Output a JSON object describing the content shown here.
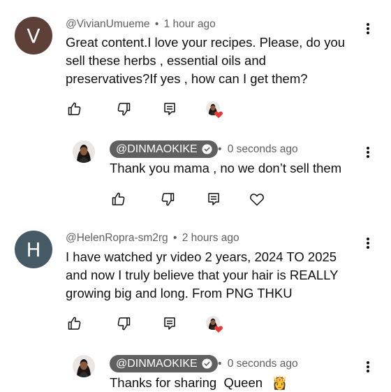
{
  "comments": [
    {
      "avatar_letter": "V",
      "avatar_color": "#5d4037",
      "author": "@VivianUmueme",
      "time": "1 hour ago",
      "text_lines": [
        "Great content.I love your recipes. Please, do you",
        "sell these herbs , essential oils and",
        "preservatives?If yes , how can I get them?"
      ],
      "reply": {
        "author": "@DINMAOKIKE",
        "time": "0 seconds ago",
        "text": "Thank you mama , no we don’t sell them"
      }
    },
    {
      "avatar_letter": "H",
      "avatar_color": "#455a64",
      "author": "@HelenRopra-sm2rg",
      "time": "2 hours ago",
      "text_lines": [
        "I have watched yr video 2 years, 2024 TO 2025",
        "and now I truly believe  that your hair is REALLY",
        "growing big and long. From PNG THKU"
      ],
      "reply": {
        "author": "@DINMAOKIKE",
        "time": "0 seconds ago",
        "text": "Thanks for sharing  Queen",
        "emoji": "👸"
      }
    }
  ],
  "separator": "•",
  "icons": [
    "thumbs-up-icon",
    "thumbs-down-icon",
    "reply-icon",
    "creator-heart-icon",
    "heart-icon",
    "kebab-menu-icon",
    "verified-check-icon"
  ],
  "colors": {
    "chip_bg": "#606060",
    "heart_red": "#e53935",
    "meta_gray": "#606060"
  }
}
